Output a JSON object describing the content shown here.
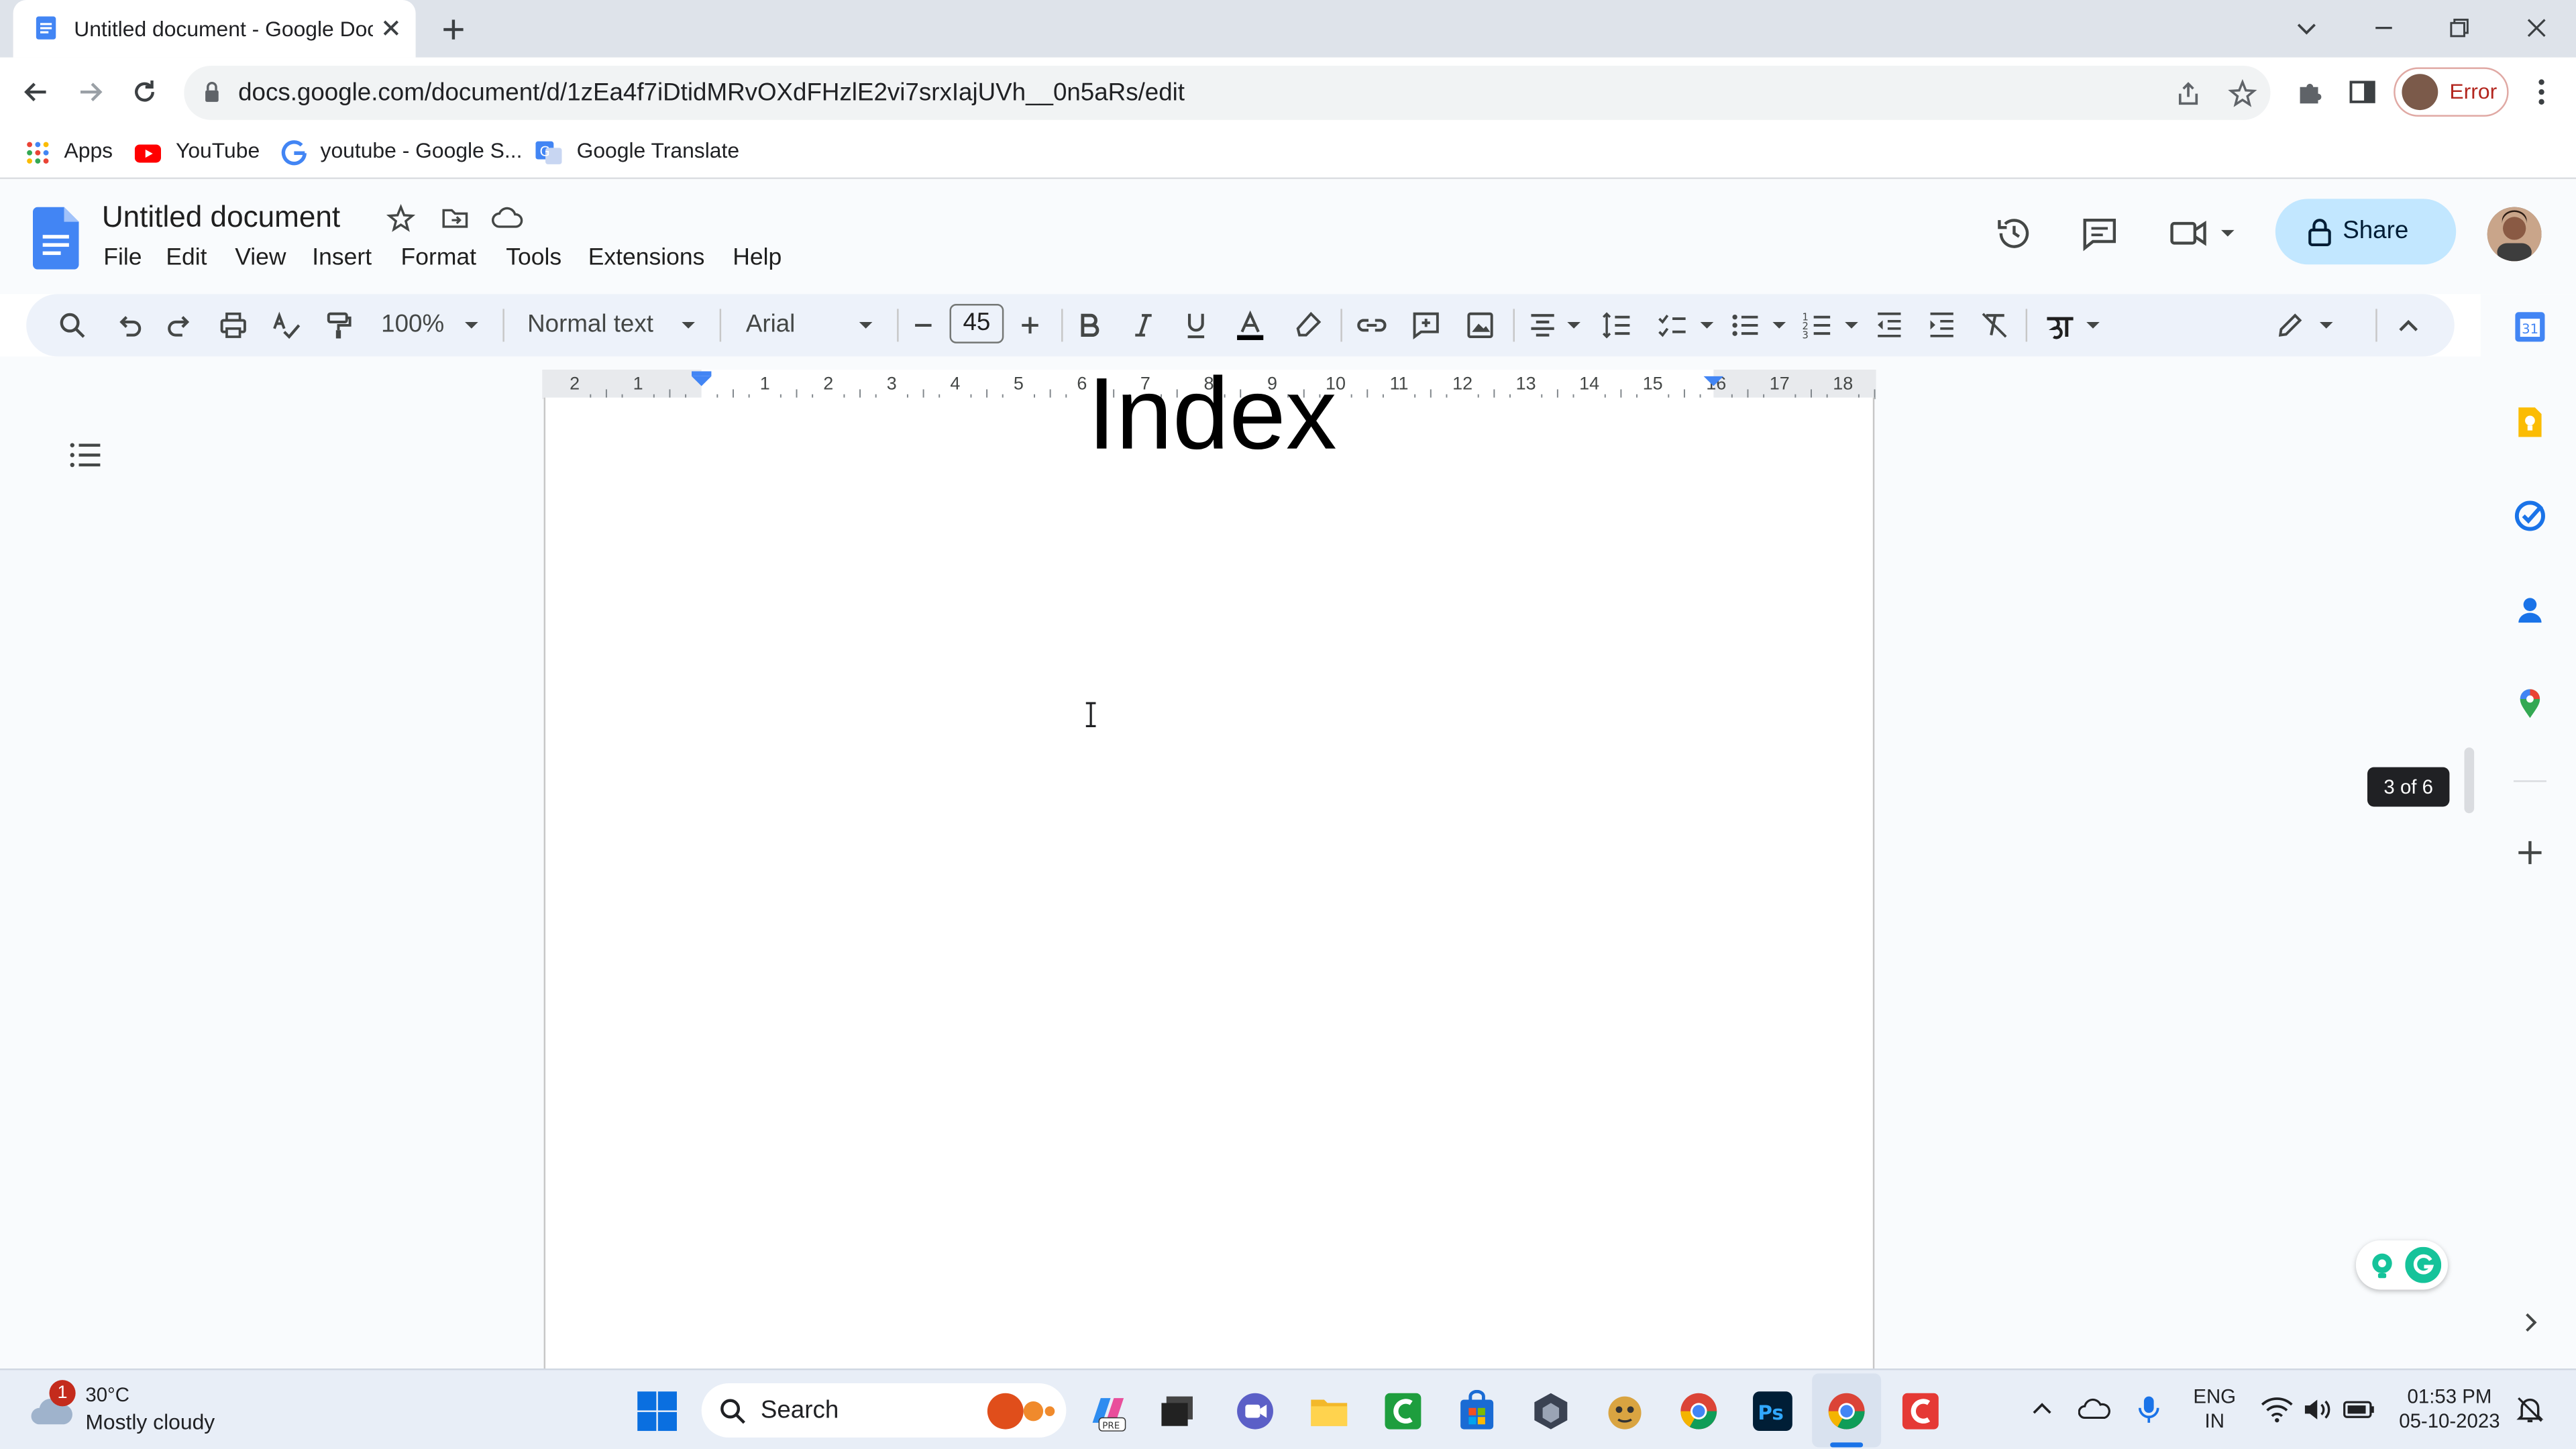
{
  "browser": {
    "tab_title": "Untitled document - Google Docs",
    "url": "docs.google.com/document/d/1zEa4f7iDtidMRvOXdFHzlE2vi7srxIajUVh__0n5aRs/edit",
    "profile_label": "Error",
    "bookmarks": [
      {
        "label": "Apps",
        "icon": "apps-grid-icon"
      },
      {
        "label": "YouTube",
        "icon": "youtube-icon"
      },
      {
        "label": "youtube - Google S...",
        "icon": "google-icon"
      },
      {
        "label": "Google Translate",
        "icon": "google-translate-icon"
      }
    ]
  },
  "docs": {
    "title": "Untitled document",
    "menu": [
      "File",
      "Edit",
      "View",
      "Insert",
      "Format",
      "Tools",
      "Extensions",
      "Help"
    ],
    "share_label": "Share",
    "toolbar": {
      "zoom": "100%",
      "style": "Normal text",
      "font": "Arial",
      "font_size": "45"
    },
    "ruler_labels": [
      "2",
      "1",
      "1",
      "2",
      "3",
      "4",
      "5",
      "6",
      "7",
      "8",
      "9",
      "10",
      "11",
      "12",
      "13",
      "14",
      "15",
      "16",
      "17",
      "18"
    ],
    "body_text": "Index",
    "page_indicator": "3 of 6"
  },
  "taskbar": {
    "weather_temp": "30°C",
    "weather_desc": "Mostly cloudy",
    "weather_badge": "1",
    "search_label": "Search",
    "lang_top": "ENG",
    "lang_bottom": "IN",
    "time": "01:53 PM",
    "date": "05-10-2023"
  },
  "colors": {
    "accent": "#1a73e8",
    "share_bg": "#c2e7ff",
    "docs_blue": "#4285f4"
  }
}
